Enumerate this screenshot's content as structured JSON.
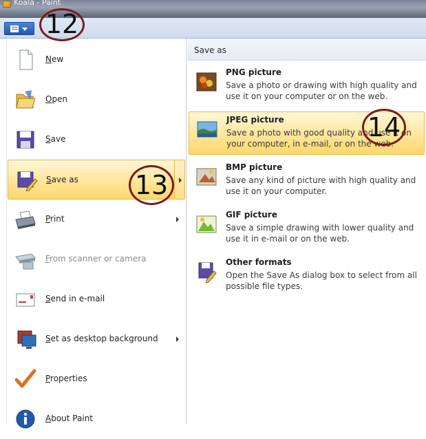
{
  "window": {
    "title": "Koala - Paint"
  },
  "app_menu": {
    "items": [
      {
        "label": "New",
        "icon": "new-document-icon",
        "disabled": false,
        "submenu": false
      },
      {
        "label": "Open",
        "icon": "open-folder-icon",
        "disabled": false,
        "submenu": false
      },
      {
        "label": "Save",
        "icon": "floppy-disk-icon",
        "disabled": false,
        "submenu": false
      },
      {
        "label": "Save as",
        "icon": "save-as-icon",
        "disabled": false,
        "submenu": true,
        "selected": true
      },
      {
        "label": "Print",
        "icon": "printer-icon",
        "disabled": false,
        "submenu": true
      },
      {
        "label": "From scanner or camera",
        "icon": "scanner-icon",
        "disabled": true,
        "submenu": false
      },
      {
        "label": "Send in e-mail",
        "icon": "email-icon",
        "disabled": false,
        "submenu": false
      },
      {
        "label": "Set as desktop background",
        "icon": "desktop-background-icon",
        "disabled": false,
        "submenu": true
      },
      {
        "label": "Properties",
        "icon": "checkmark-icon",
        "disabled": false,
        "submenu": false
      },
      {
        "label": "About Paint",
        "icon": "info-icon",
        "disabled": false,
        "submenu": false
      }
    ]
  },
  "save_as_panel": {
    "header": "Save as",
    "formats": [
      {
        "title": "PNG picture",
        "description": "Save a photo or drawing with high quality and use it on your computer or on the web.",
        "icon": "png-picture-icon"
      },
      {
        "title": "JPEG picture",
        "description": "Save a photo with good quality and use it on your computer, in e-mail, or on the web.",
        "icon": "jpeg-picture-icon",
        "highlighted": true
      },
      {
        "title": "BMP picture",
        "description": "Save any kind of picture with high quality and use it on your computer.",
        "icon": "bmp-picture-icon"
      },
      {
        "title": "GIF picture",
        "description": "Save a simple drawing with lower quality and use it in e-mail or on the web.",
        "icon": "gif-picture-icon"
      },
      {
        "title": "Other formats",
        "description": "Open the Save As dialog box to select from all possible file types.",
        "icon": "other-formats-icon"
      }
    ]
  },
  "annotations": [
    {
      "number": "12"
    },
    {
      "number": "13"
    },
    {
      "number": "14"
    }
  ],
  "colors": {
    "selection_gradient_top": "#fff7d8",
    "selection_gradient_bottom": "#ffd76a",
    "selection_border": "#e8b949",
    "ribbon_blue": "#1f5aad",
    "annotation_ring": "#7a1a1a"
  }
}
